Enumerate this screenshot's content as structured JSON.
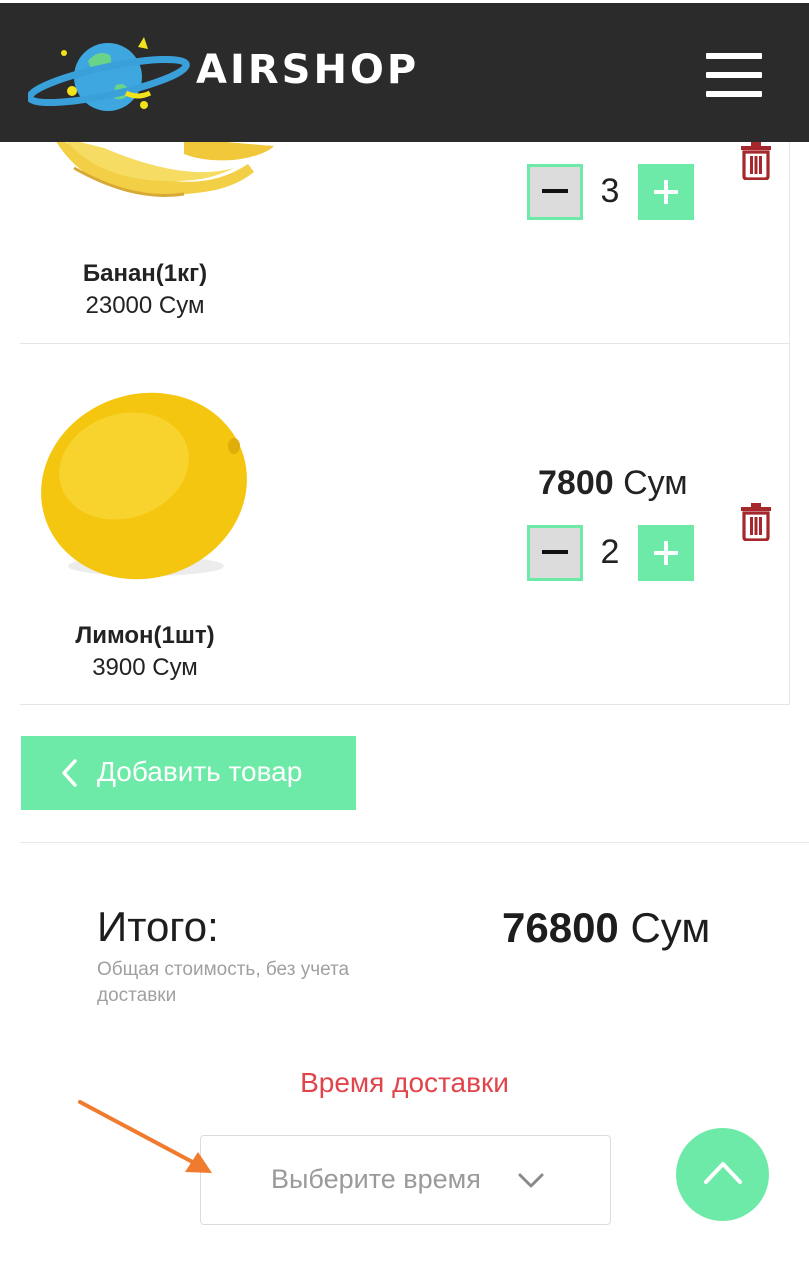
{
  "header": {
    "brand": "AIRSHOP",
    "menu_icon": "hamburger-menu-icon"
  },
  "cart": {
    "currency": "Сум",
    "items": [
      {
        "name": "Банан(1кг)",
        "unit_price": "23000 Сум",
        "quantity": "3",
        "image_icon": "banana-image"
      },
      {
        "name": "Лимон(1шт)",
        "unit_price": "3900 Сум",
        "line_total": "7800",
        "quantity": "2",
        "image_icon": "lemon-image"
      }
    ],
    "minus_icon": "minus-icon",
    "plus_icon": "plus-icon",
    "delete_icon": "trash-icon"
  },
  "actions": {
    "add_product_label": "Добавить товар"
  },
  "summary": {
    "total_label": "Итого:",
    "total_note": "Общая стоимость, без учета доставки",
    "total_amount": "76800",
    "currency": "Сум"
  },
  "delivery": {
    "title": "Время доставки",
    "select_placeholder": "Выберите время"
  },
  "colors": {
    "header_bg": "#2b2b2b",
    "accent_green": "#6eeaa8",
    "delivery_red": "#e0454b",
    "trash_red": "#a5272b",
    "annotation_orange": "#f07b2e"
  }
}
